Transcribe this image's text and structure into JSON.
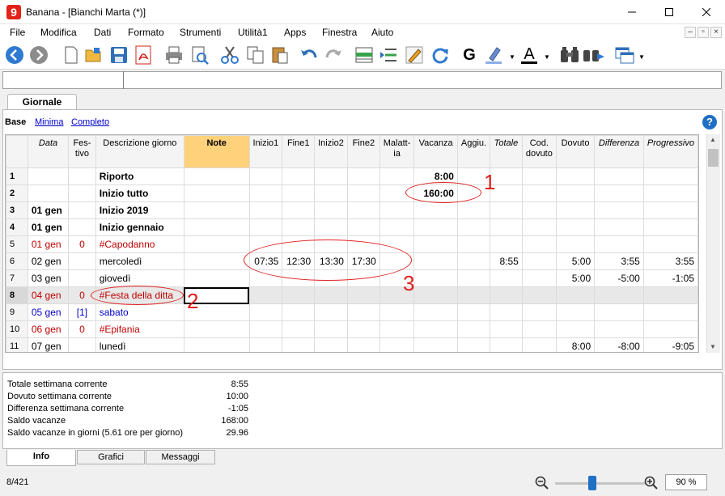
{
  "window": {
    "title": "Banana - [Bianchi Marta (*)]"
  },
  "menu": [
    "File",
    "Modifica",
    "Dati",
    "Formato",
    "Strumenti",
    "Utilità1",
    "Apps",
    "Finestra",
    "Aiuto"
  ],
  "toolbar": {
    "bold_glyph": "G",
    "font_color_glyph": "A"
  },
  "tabs": {
    "active": "Giornale"
  },
  "views": {
    "current": "Base",
    "minima": "Minima",
    "completo": "Completo"
  },
  "help": {
    "glyph": "?"
  },
  "columns": [
    "",
    "Data",
    "Fes-tivo",
    "Descrizione giorno",
    "Note",
    "Inizio1",
    "Fine1",
    "Inizio2",
    "Fine2",
    "Malatt-ia",
    "Vacanza",
    "Aggiu.",
    "Totale",
    "Cod. dovuto",
    "Dovuto",
    "Differenza",
    "Progressivo"
  ],
  "rows": [
    {
      "n": "1",
      "data": "",
      "festivo": "",
      "desc": "Riporto",
      "note": "",
      "i1": "",
      "f1": "",
      "i2": "",
      "f2": "",
      "mal": "",
      "vac": "8:00",
      "agg": "",
      "tot": "",
      "cod": "",
      "dov": "",
      "diff": "",
      "prog": ""
    },
    {
      "n": "2",
      "data": "",
      "festivo": "",
      "desc": "Inizio tutto",
      "note": "",
      "i1": "",
      "f1": "",
      "i2": "",
      "f2": "",
      "mal": "",
      "vac": "160:00",
      "agg": "",
      "tot": "",
      "cod": "",
      "dov": "",
      "diff": "",
      "prog": ""
    },
    {
      "n": "3",
      "data": "01 gen",
      "festivo": "",
      "desc": "Inizio 2019",
      "note": "",
      "i1": "",
      "f1": "",
      "i2": "",
      "f2": "",
      "mal": "",
      "vac": "",
      "agg": "",
      "tot": "",
      "cod": "",
      "dov": "",
      "diff": "",
      "prog": ""
    },
    {
      "n": "4",
      "data": "01 gen",
      "festivo": "",
      "desc": "Inizio gennaio",
      "note": "",
      "i1": "",
      "f1": "",
      "i2": "",
      "f2": "",
      "mal": "",
      "vac": "",
      "agg": "",
      "tot": "",
      "cod": "",
      "dov": "",
      "diff": "",
      "prog": ""
    },
    {
      "n": "5",
      "data": "01 gen",
      "festivo": "0",
      "desc": "#Capodanno",
      "note": "",
      "i1": "",
      "f1": "",
      "i2": "",
      "f2": "",
      "mal": "",
      "vac": "",
      "agg": "",
      "tot": "",
      "cod": "",
      "dov": "",
      "diff": "",
      "prog": ""
    },
    {
      "n": "6",
      "data": "02 gen",
      "festivo": "",
      "desc": "mercoledì",
      "note": "",
      "i1": "07:35",
      "f1": "12:30",
      "i2": "13:30",
      "f2": "17:30",
      "mal": "",
      "vac": "",
      "agg": "",
      "tot": "8:55",
      "cod": "",
      "dov": "5:00",
      "diff": "3:55",
      "prog": "3:55"
    },
    {
      "n": "7",
      "data": "03 gen",
      "festivo": "",
      "desc": "giovedì",
      "note": "",
      "i1": "",
      "f1": "",
      "i2": "",
      "f2": "",
      "mal": "",
      "vac": "",
      "agg": "",
      "tot": "",
      "cod": "",
      "dov": "5:00",
      "diff": "-5:00",
      "prog": "-1:05"
    },
    {
      "n": "8",
      "data": "04 gen",
      "festivo": "0",
      "desc": "#Festa della ditta",
      "note": "",
      "i1": "",
      "f1": "",
      "i2": "",
      "f2": "",
      "mal": "",
      "vac": "",
      "agg": "",
      "tot": "",
      "cod": "",
      "dov": "",
      "diff": "",
      "prog": ""
    },
    {
      "n": "9",
      "data": "05 gen",
      "festivo": "[1]",
      "desc": "sabato",
      "note": "",
      "i1": "",
      "f1": "",
      "i2": "",
      "f2": "",
      "mal": "",
      "vac": "",
      "agg": "",
      "tot": "",
      "cod": "",
      "dov": "",
      "diff": "",
      "prog": ""
    },
    {
      "n": "10",
      "data": "06 gen",
      "festivo": "0",
      "desc": "#Epifania",
      "note": "",
      "i1": "",
      "f1": "",
      "i2": "",
      "f2": "",
      "mal": "",
      "vac": "",
      "agg": "",
      "tot": "",
      "cod": "",
      "dov": "",
      "diff": "",
      "prog": ""
    },
    {
      "n": "11",
      "data": "07 gen",
      "festivo": "",
      "desc": "lunedì",
      "note": "",
      "i1": "",
      "f1": "",
      "i2": "",
      "f2": "",
      "mal": "",
      "vac": "",
      "agg": "",
      "tot": "",
      "cod": "",
      "dov": "8:00",
      "diff": "-8:00",
      "prog": "-9:05"
    }
  ],
  "annotations": [
    "1",
    "2",
    "3"
  ],
  "info": [
    {
      "label": "Totale settimana corrente",
      "value": "8:55"
    },
    {
      "label": "Dovuto settimana corrente",
      "value": "10:00"
    },
    {
      "label": "Differenza settimana corrente",
      "value": "-1:05"
    },
    {
      "label": "Saldo vacanze",
      "value": "168:00"
    },
    {
      "label": "Saldo vacanze in giorni (5.61 ore per giorno)",
      "value": "29.96"
    }
  ],
  "bottom_tabs": [
    "Info",
    "Grafici",
    "Messaggi"
  ],
  "status": {
    "position": "8/421",
    "zoom": "90 %",
    "zoom_level_percent": 90
  },
  "colors": {
    "note_header": "#ffd17a",
    "holiday_red": "#c00000",
    "saturday_blue": "#0000cc",
    "annotation_red": "#e02020",
    "accent_blue": "#1f6fc4"
  }
}
